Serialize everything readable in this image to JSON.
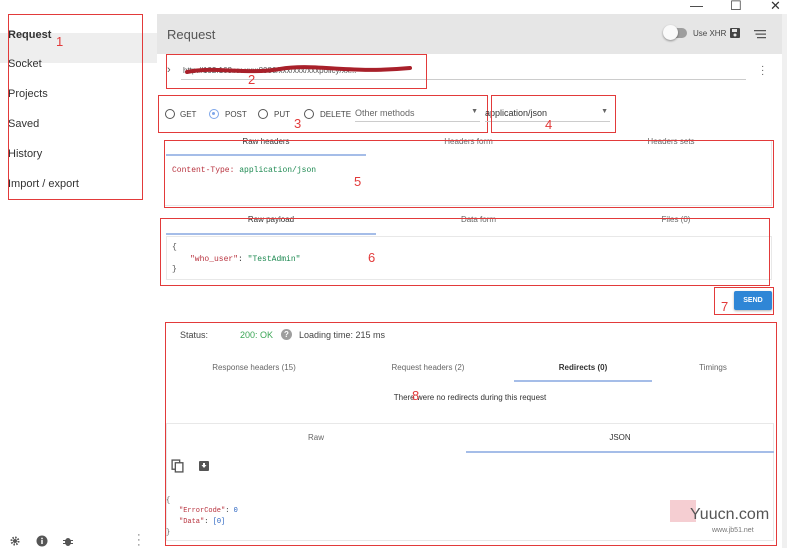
{
  "window": {
    "minimize": "—",
    "maximize": "☐",
    "close": "✕"
  },
  "sidebar": {
    "items": [
      {
        "label": "Request"
      },
      {
        "label": "Socket"
      },
      {
        "label": "Projects"
      },
      {
        "label": "Saved"
      },
      {
        "label": "History"
      },
      {
        "label": "Import / export"
      }
    ],
    "footer_icons": [
      "gear-icon",
      "info-icon",
      "bug-icon",
      "more-vert-icon"
    ]
  },
  "header": {
    "title": "Request",
    "use_xhr_label": "Use XHR"
  },
  "url": {
    "value": "http://192.168.xx.xxx:8080/xxx/xxx/xxxpolicy/xx..."
  },
  "methods": {
    "options": [
      "GET",
      "POST",
      "PUT",
      "DELETE"
    ],
    "selected": "POST",
    "other": "Other methods"
  },
  "content_type": {
    "value": "application/json"
  },
  "headers_panel": {
    "tabs": [
      "Raw headers",
      "Headers form",
      "Headers sets"
    ],
    "header_key": "Content-Type:",
    "header_value": "application/json"
  },
  "payload_panel": {
    "tabs": [
      "Raw payload",
      "Data form",
      "Files (0)"
    ],
    "open": "{",
    "key": "\"who_user\"",
    "colon": ":",
    "value": "\"TestAdmin\"",
    "close": "}"
  },
  "send_label": "SEND",
  "response": {
    "status_label": "Status:",
    "status_value": "200: OK",
    "loading": "Loading time: 215 ms",
    "tabs": [
      "Response headers (15)",
      "Request headers (2)",
      "Redirects (0)",
      "Timings"
    ],
    "redirect_msg": "There were no redirects during this request",
    "view_tabs": [
      "Raw",
      "JSON"
    ],
    "json_open": "{",
    "k1": "\"ErrorCode\"",
    "v1": "0",
    "k2": "\"Data\"",
    "v2": "[0]",
    "json_close": "}"
  },
  "annotations": [
    "1",
    "2",
    "3",
    "4",
    "5",
    "6",
    "7",
    "8"
  ],
  "watermark": {
    "brand": "Yuucn.com",
    "sub": "www.jb51.net"
  },
  "colors": {
    "accent": "#2f86d6",
    "ok": "#3aa655",
    "annotation": "#e23a3a"
  }
}
